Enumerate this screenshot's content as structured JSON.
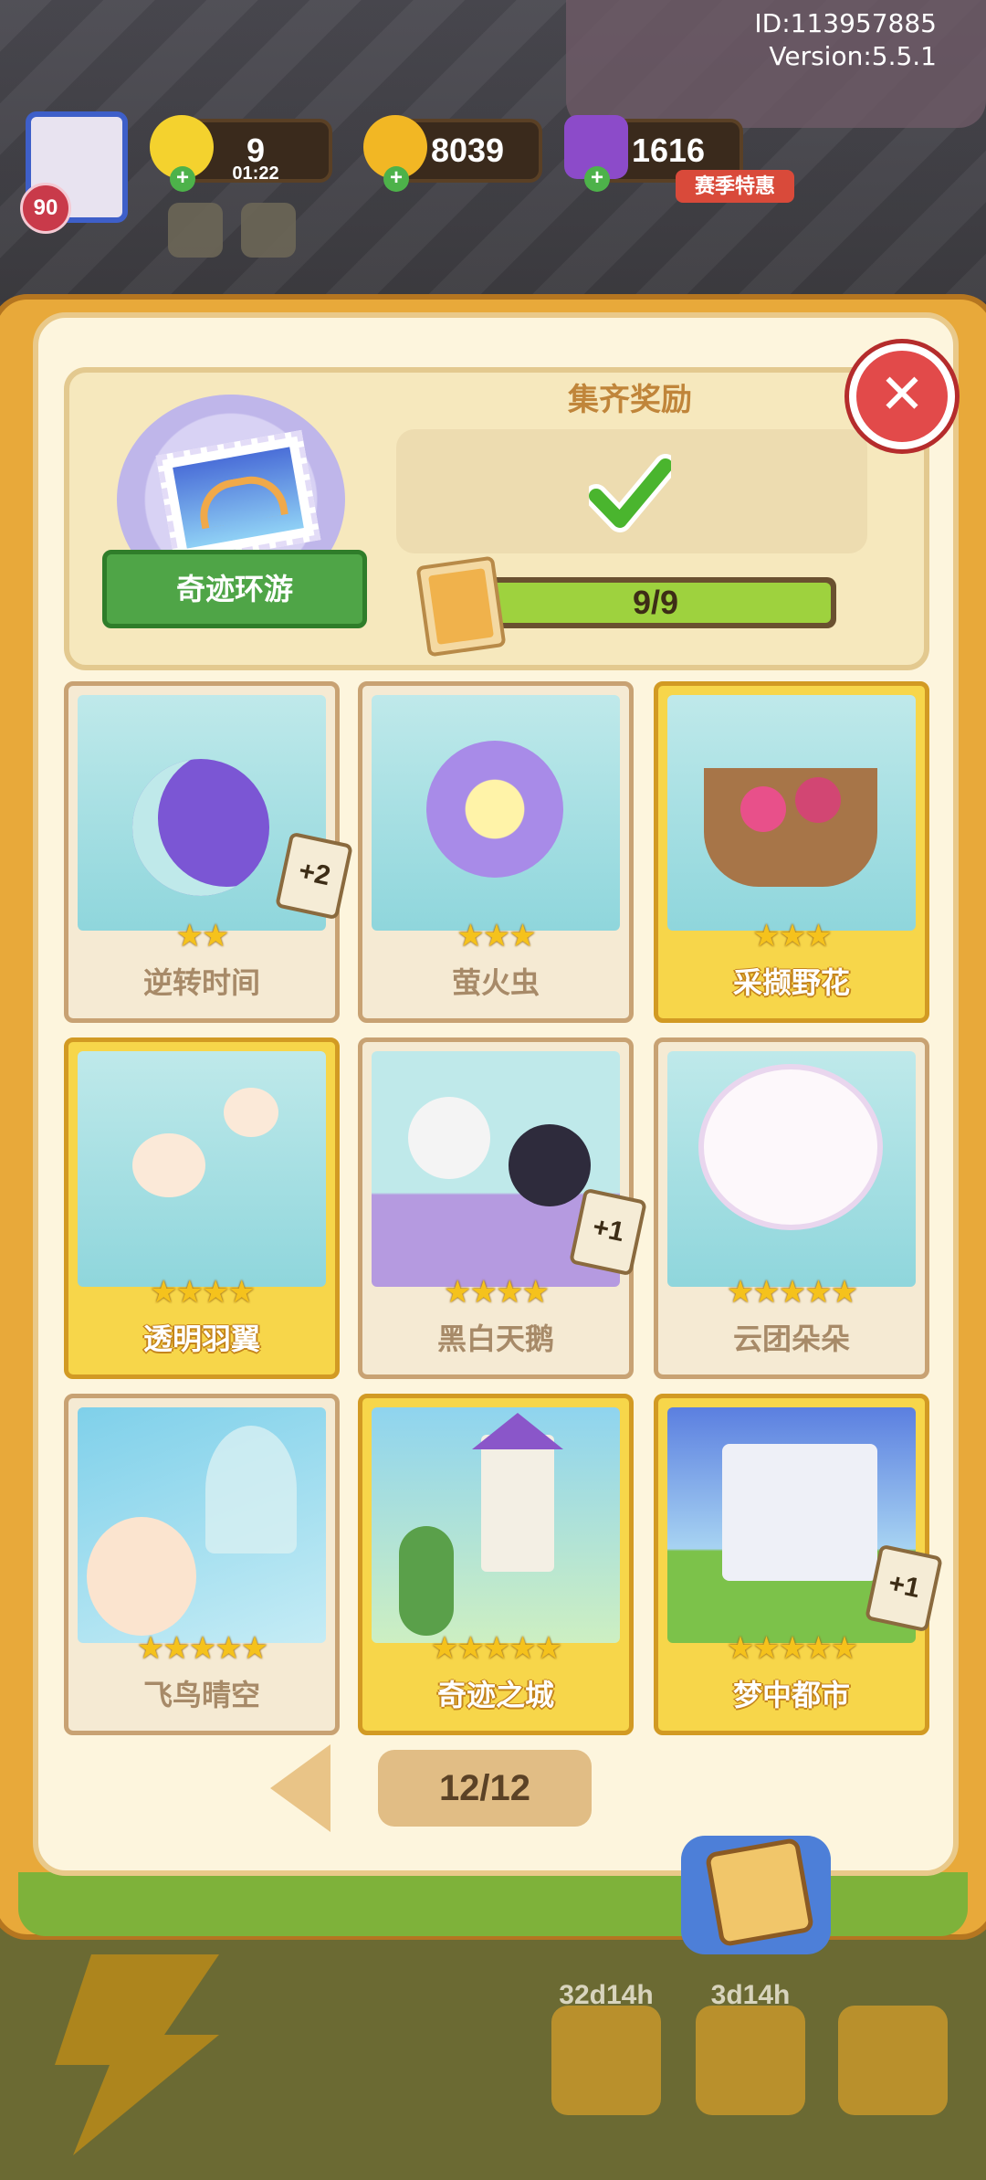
{
  "hud": {
    "id_text": "ID:113957885",
    "version_text": "Version:5.5.1",
    "level": "90",
    "energy": "9",
    "energy_timer": "01:22",
    "coins": "8039",
    "gems": "1616",
    "season_sale": "赛季特惠"
  },
  "collection": {
    "set_name": "奇迹环游",
    "reward_title": "集齐奖励",
    "progress_text": "9/9",
    "progress": 1.0,
    "close_icon": "close-icon",
    "check_icon": "checkmark-icon"
  },
  "cards": [
    {
      "name": "逆转时间",
      "stars": "★★",
      "badge": "+2",
      "gold": false
    },
    {
      "name": "萤火虫",
      "stars": "★★★",
      "badge": "",
      "gold": false
    },
    {
      "name": "采撷野花",
      "stars": "★★★",
      "badge": "",
      "gold": true
    },
    {
      "name": "透明羽翼",
      "stars": "★★★★",
      "badge": "",
      "gold": true
    },
    {
      "name": "黑白天鹅",
      "stars": "★★★★",
      "badge": "+1",
      "gold": false
    },
    {
      "name": "云团朵朵",
      "stars": "★★★★★",
      "badge": "",
      "gold": false
    },
    {
      "name": "飞鸟晴空",
      "stars": "★★★★★",
      "badge": "",
      "gold": false
    },
    {
      "name": "奇迹之城",
      "stars": "★★★★★",
      "badge": "",
      "gold": true
    },
    {
      "name": "梦中都市",
      "stars": "★★★★★",
      "badge": "+1",
      "gold": true
    }
  ],
  "pager": {
    "text": "12/12"
  },
  "lower": {
    "timer1": "32d14h",
    "timer2": "3d14h"
  },
  "colors": {
    "accent_gold": "#f7d64a",
    "close_red": "#e24a4a",
    "progress_green": "#9ed23e"
  }
}
